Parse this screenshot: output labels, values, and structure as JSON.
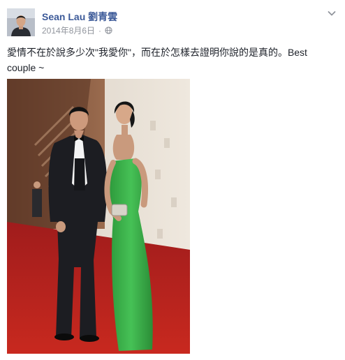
{
  "post": {
    "author_name": "Sean Lau 劉青雲",
    "timestamp": "2014年8月6日",
    "separator": "·",
    "privacy_icon": "globe-icon",
    "options_icon": "chevron-down-icon",
    "text": "愛情不在於說多少次\"我愛你\"，而在於怎樣去證明你說的是真的。Best couple ~",
    "colors": {
      "author_link": "#3b5998",
      "meta_text": "#90949c",
      "body_text": "#1d2129"
    }
  }
}
